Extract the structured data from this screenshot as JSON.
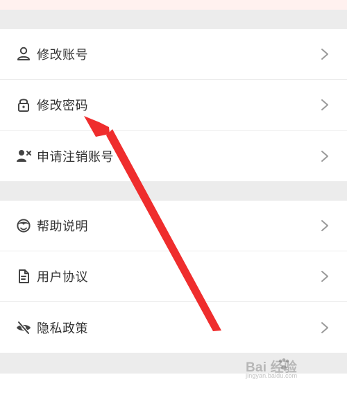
{
  "settings": {
    "account": {
      "items": [
        {
          "label": "修改账号",
          "icon": "user-icon"
        },
        {
          "label": "修改密码",
          "icon": "lock-icon"
        },
        {
          "label": "申请注销账号",
          "icon": "user-remove-icon"
        }
      ]
    },
    "help": {
      "items": [
        {
          "label": "帮助说明",
          "icon": "help-avatar-icon"
        },
        {
          "label": "用户协议",
          "icon": "document-icon"
        },
        {
          "label": "隐私政策",
          "icon": "eye-off-icon"
        }
      ]
    }
  },
  "watermark": {
    "main": "Bai 经验",
    "sub": "jingyan.baidu.com"
  },
  "colors": {
    "arrow": "#ef2d2d",
    "text": "#333333",
    "chevron": "#9a9a9a"
  }
}
